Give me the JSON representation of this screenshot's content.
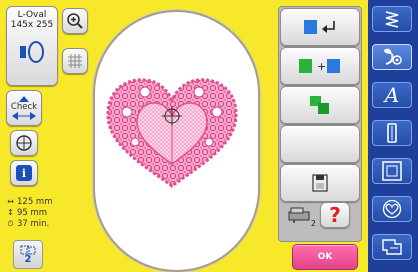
{
  "hoop": {
    "name": "L-Oval",
    "size": "145x 255"
  },
  "left_tools": {
    "check_label": "Check",
    "info_label": "i"
  },
  "stats": {
    "width": "125 mm",
    "height": "95 mm",
    "time": "37 min."
  },
  "pages": {
    "number": "2"
  },
  "right_panel": {
    "help_label": "?",
    "ok_label": "OK",
    "badge_number": "2"
  },
  "colors": {
    "background": "#f7e92a",
    "accent_blue": "#1c4fb8",
    "ok_pink": "#e2418b",
    "help_red": "#e02020",
    "motif_pink": "#e8559a",
    "sidebar_blue": "#1f3f9a"
  },
  "sidebar": {
    "items": [
      {
        "icon": "stitch-zigzag-icon"
      },
      {
        "icon": "embroidery-flower-icon"
      },
      {
        "icon": "letter-a-icon"
      },
      {
        "icon": "buttonhole-icon"
      },
      {
        "icon": "frame-icon"
      },
      {
        "icon": "heart-personal-icon"
      },
      {
        "icon": "settings-icon"
      }
    ]
  }
}
